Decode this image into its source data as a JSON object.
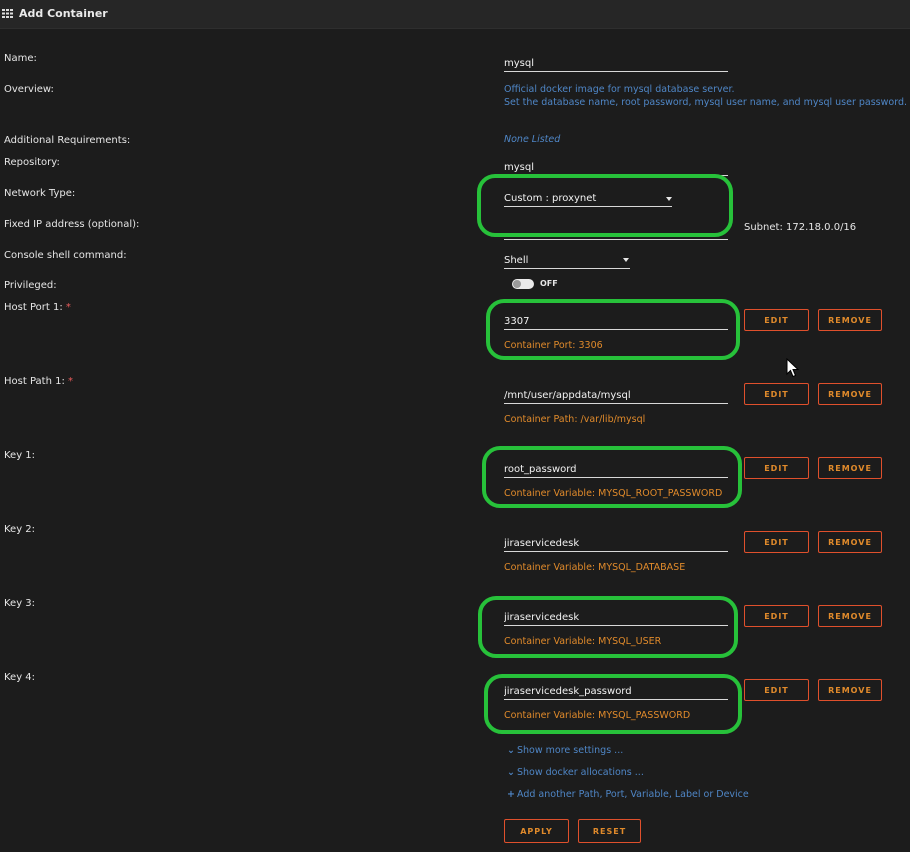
{
  "window": {
    "title": "Add Container"
  },
  "labels": {
    "name": "Name:",
    "overview": "Overview:",
    "additional_requirements": "Additional Requirements:",
    "repository": "Repository:",
    "network_type": "Network Type:",
    "fixed_ip": "Fixed IP address (optional):",
    "console_shell": "Console shell command:",
    "privileged": "Privileged:",
    "required_mark": "*"
  },
  "values": {
    "name": "mysql",
    "overview_line1": "Official docker image for mysql database server.",
    "overview_line2": "Set the database name, root password, mysql user name, and mysql user password.",
    "additional_requirements": "None Listed",
    "repository": "mysql",
    "network_type": "Custom : proxynet",
    "fixed_ip": "",
    "subnet": "Subnet: 172.18.0.0/16",
    "console_shell": "Shell",
    "privileged_state": "OFF"
  },
  "config_items": [
    {
      "label": "Host Port 1:",
      "required": true,
      "value": "3307",
      "sub": "Container Port: 3306"
    },
    {
      "label": "Host Path 1:",
      "required": true,
      "value": "/mnt/user/appdata/mysql",
      "sub": "Container Path: /var/lib/mysql"
    },
    {
      "label": "Key 1:",
      "required": false,
      "value": "root_password",
      "sub": "Container Variable: MYSQL_ROOT_PASSWORD"
    },
    {
      "label": "Key 2:",
      "required": false,
      "value": "jiraservicedesk",
      "sub": "Container Variable: MYSQL_DATABASE"
    },
    {
      "label": "Key 3:",
      "required": false,
      "value": "jiraservicedesk",
      "sub": "Container Variable: MYSQL_USER"
    },
    {
      "label": "Key 4:",
      "required": false,
      "value": "jiraservicedesk_password",
      "sub": "Container Variable: MYSQL_PASSWORD"
    }
  ],
  "buttons": {
    "edit": "EDIT",
    "remove": "REMOVE",
    "apply": "APPLY",
    "reset": "RESET"
  },
  "links": {
    "show_more_settings": "Show more settings ...",
    "show_docker_allocations": "Show docker allocations ...",
    "add_another": "Add another Path, Port, Variable, Label or Device"
  },
  "colors": {
    "background": "#1c1c1c",
    "link_blue": "#4f86c6",
    "accent_orange": "#e08a2b",
    "button_border": "#e0502c",
    "highlight_green": "#27c13a"
  }
}
